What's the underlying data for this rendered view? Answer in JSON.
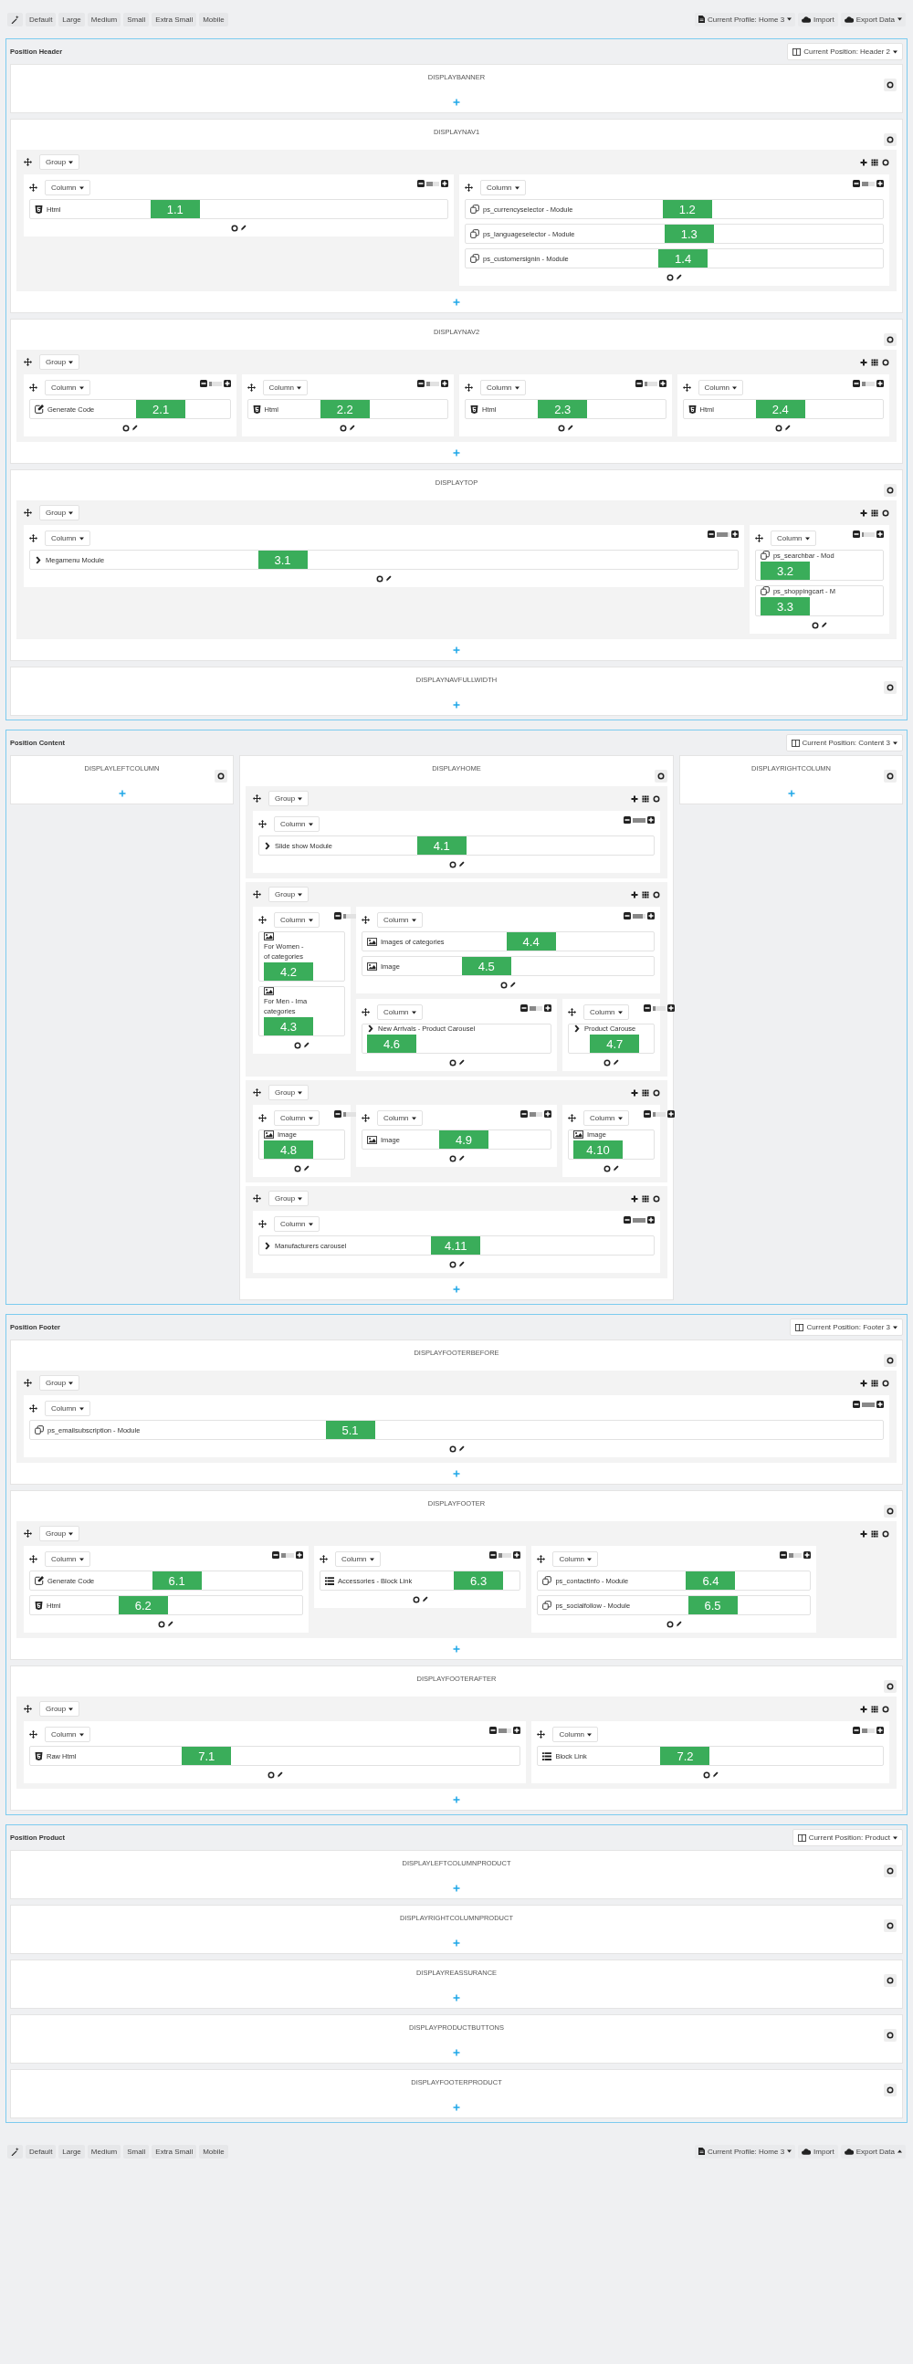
{
  "toolbar_top": {
    "devices": [
      "Default",
      "Large",
      "Medium",
      "Small",
      "Extra Small",
      "Mobile"
    ],
    "profile": "Current Profile: Home 3",
    "import": "Import",
    "export": "Export Data",
    "export_dropup": false
  },
  "positions": [
    {
      "title": "Position Header",
      "current": "Current Position: Header 2",
      "side_by_side": false,
      "hooks": [
        {
          "name": "DISPLAYBANNER"
        },
        {
          "name": "DISPLAYNAV1",
          "groups": [
            {
              "label": "Group",
              "columns": [
                {
                  "label": "Column",
                  "level": 0.5,
                  "modules": [
                    {
                      "kind": "html",
                      "label": "Html",
                      "badge": "1.1"
                    }
                  ]
                },
                {
                  "label": "Column",
                  "level": 0.5,
                  "modules": [
                    {
                      "kind": "module",
                      "label": "ps_currencyselector - Module",
                      "badge": "1.2"
                    },
                    {
                      "kind": "module",
                      "label": "ps_languageselector - Module",
                      "badge": "1.3"
                    },
                    {
                      "kind": "module",
                      "label": "ps_customersignin - Module",
                      "badge": "1.4"
                    }
                  ]
                }
              ]
            }
          ]
        },
        {
          "name": "DISPLAYNAV2",
          "groups": [
            {
              "label": "Group",
              "columns": [
                {
                  "label": "Column",
                  "level": 0.25,
                  "modules": [
                    {
                      "kind": "edit",
                      "label": "Generate Code",
                      "badge": "2.1"
                    }
                  ]
                },
                {
                  "label": "Column",
                  "level": 0.25,
                  "modules": [
                    {
                      "kind": "html",
                      "label": "Html",
                      "badge": "2.2"
                    }
                  ]
                },
                {
                  "label": "Column",
                  "level": 0.25,
                  "modules": [
                    {
                      "kind": "html",
                      "label": "Html",
                      "badge": "2.3"
                    }
                  ]
                },
                {
                  "label": "Column",
                  "level": 0.25,
                  "modules": [
                    {
                      "kind": "html",
                      "label": "Html",
                      "badge": "2.4"
                    }
                  ]
                }
              ]
            }
          ]
        },
        {
          "name": "DISPLAYTOP",
          "groups": [
            {
              "label": "Group",
              "columns": [
                {
                  "label": "Column",
                  "level": 0.8333,
                  "modules": [
                    {
                      "kind": "chevron",
                      "label": "Megamenu Module",
                      "badge": "3.1"
                    }
                  ]
                },
                {
                  "label": "Column",
                  "level": 0.1667,
                  "modules": [
                    {
                      "kind": "module",
                      "label": "ps_searchbar - Mod",
                      "badge": "3.2"
                    },
                    {
                      "kind": "module",
                      "label": "ps_shoppingcart - M",
                      "badge": "3.3"
                    }
                  ]
                }
              ]
            }
          ]
        },
        {
          "name": "DISPLAYNAVFULLWIDTH"
        }
      ]
    },
    {
      "title": "Position Content",
      "current": "Current Position: Content 3",
      "side_by_side": true,
      "hooks": [
        {
          "name": "DISPLAYLEFTCOLUMN"
        },
        {
          "name": "DISPLAYHOME",
          "groups": [
            {
              "label": "Group",
              "columns": [
                {
                  "label": "Column",
                  "level": 1,
                  "modules": [
                    {
                      "kind": "chevron",
                      "label": "Slide show Module",
                      "badge": "4.1"
                    }
                  ]
                }
              ]
            },
            {
              "label": "Group",
              "columns": [
                {
                  "label": "Column",
                  "level": 0.25,
                  "modules": [
                    {
                      "kind": "image",
                      "label": "For Women -",
                      "label_continued": "of categories",
                      "badge": "4.2"
                    },
                    {
                      "kind": "image",
                      "label": "For Men - Ima",
                      "label_continued": "categories",
                      "badge": "4.3"
                    }
                  ]
                },
                {
                  "label": "Column",
                  "level": 0.75,
                  "modules": [
                    {
                      "kind": "image",
                      "label": "Images of categories",
                      "badge": "4.4"
                    },
                    {
                      "kind": "image",
                      "label": "Image",
                      "badge": "4.5"
                    }
                  ]
                },
                {
                  "label": "Column",
                  "level": 0.5,
                  "modules": [
                    {
                      "kind": "chevron",
                      "label": "New Arrivals - Product Carousel",
                      "badge": "4.6"
                    }
                  ]
                },
                {
                  "label": "Column",
                  "level": 0.25,
                  "modules": [
                    {
                      "kind": "chevron",
                      "label": "Product Carouse",
                      "badge": "4.7"
                    }
                  ]
                }
              ]
            },
            {
              "label": "Group",
              "columns": [
                {
                  "label": "Column",
                  "level": 0.25,
                  "modules": [
                    {
                      "kind": "image",
                      "label": "Image",
                      "badge": "4.8"
                    }
                  ]
                },
                {
                  "label": "Column",
                  "level": 0.5,
                  "modules": [
                    {
                      "kind": "image",
                      "label": "Image",
                      "badge": "4.9"
                    }
                  ]
                },
                {
                  "label": "Column",
                  "level": 0.25,
                  "modules": [
                    {
                      "kind": "image",
                      "label": "Image",
                      "badge": "4.10"
                    }
                  ]
                }
              ]
            },
            {
              "label": "Group",
              "columns": [
                {
                  "label": "Column",
                  "level": 1,
                  "modules": [
                    {
                      "kind": "chevron",
                      "label": "Manufacturers carousel",
                      "badge": "4.11"
                    }
                  ]
                }
              ]
            }
          ]
        },
        {
          "name": "DISPLAYRIGHTCOLUMN"
        }
      ]
    },
    {
      "title": "Position Footer",
      "current": "Current Position: Footer 3",
      "side_by_side": false,
      "hooks": [
        {
          "name": "DISPLAYFOOTERBEFORE",
          "groups": [
            {
              "label": "Group",
              "columns": [
                {
                  "label": "Column",
                  "level": 1,
                  "modules": [
                    {
                      "kind": "module",
                      "label": "ps_emailsubscription - Module",
                      "badge": "5.1"
                    }
                  ]
                }
              ]
            }
          ]
        },
        {
          "name": "DISPLAYFOOTER",
          "groups": [
            {
              "label": "Group",
              "columns": [
                {
                  "label": "Column",
                  "level": 0.3333,
                  "modules": [
                    {
                      "kind": "edit",
                      "label": "Generate Code",
                      "badge": "6.1"
                    },
                    {
                      "kind": "html",
                      "label": "Html",
                      "badge": "6.2"
                    }
                  ]
                },
                {
                  "label": "Column",
                  "level": 0.25,
                  "modules": [
                    {
                      "kind": "list",
                      "label": "Accessories - Block Link",
                      "badge": "6.3"
                    }
                  ]
                },
                {
                  "label": "Column",
                  "level": 0.3333,
                  "modules": [
                    {
                      "kind": "module",
                      "label": "ps_contactinfo - Module",
                      "badge": "6.4"
                    },
                    {
                      "kind": "module",
                      "label": "ps_socialfollow - Module",
                      "badge": "6.5"
                    }
                  ]
                }
              ]
            }
          ]
        },
        {
          "name": "DISPLAYFOOTERAFTER",
          "groups": [
            {
              "label": "Group",
              "columns": [
                {
                  "label": "Column",
                  "level": 0.5833,
                  "modules": [
                    {
                      "kind": "html",
                      "label": "Raw Html",
                      "badge": "7.1"
                    }
                  ]
                },
                {
                  "label": "Column",
                  "level": 0.4167,
                  "modules": [
                    {
                      "kind": "list",
                      "label": "Block Link",
                      "badge": "7.2"
                    }
                  ]
                }
              ]
            }
          ]
        }
      ]
    },
    {
      "title": "Position Product",
      "current": "Current Position: Product",
      "side_by_side": false,
      "hooks": [
        {
          "name": "DISPLAYLEFTCOLUMNPRODUCT"
        },
        {
          "name": "DISPLAYRIGHTCOLUMNPRODUCT"
        },
        {
          "name": "DISPLAYREASSURANCE"
        },
        {
          "name": "DISPLAYPRODUCTBUTTONS"
        },
        {
          "name": "DISPLAYFOOTERPRODUCT"
        }
      ]
    }
  ],
  "toolbar_bottom": {
    "devices": [
      "Default",
      "Large",
      "Medium",
      "Small",
      "Extra Small",
      "Mobile"
    ],
    "profile": "Current Profile: Home 3",
    "import": "Import",
    "export": "Export Data",
    "export_dropup": true
  }
}
